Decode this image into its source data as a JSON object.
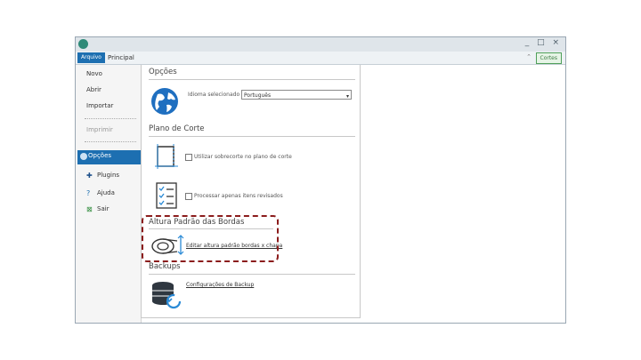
{
  "titlebar": {
    "controls": "_ □ ×"
  },
  "ribbon": {
    "file_tab": "Arquivo",
    "main_tab": "Principal",
    "up_glyph": "⌃",
    "right_button": "Cortes"
  },
  "sidebar": {
    "items": [
      {
        "label": "Novo"
      },
      {
        "label": "Abrir"
      },
      {
        "label": "Importar"
      },
      {
        "label": "Imprimir"
      },
      {
        "label": "Opções"
      },
      {
        "label": "Plugins"
      },
      {
        "label": "Ajuda"
      },
      {
        "label": "Sair"
      }
    ]
  },
  "sections": {
    "opcoes": {
      "title": "Opções",
      "language_label": "Idioma selecionado",
      "language_value": "Português"
    },
    "plano": {
      "title": "Plano de Corte",
      "checkbox_label": "Utilizar sobrecorte no plano de corte"
    },
    "process": {
      "checkbox_label": "Processar apenas itens revisados"
    },
    "altura": {
      "title": "Altura Padrão das Bordas",
      "link_label": "Editar altura padrão bordas x chapa"
    },
    "backups": {
      "title": "Backups",
      "link_label": "Configurações de Backup"
    }
  },
  "colors": {
    "accent": "#1d6fb1",
    "highlight": "#8b1c1c"
  }
}
